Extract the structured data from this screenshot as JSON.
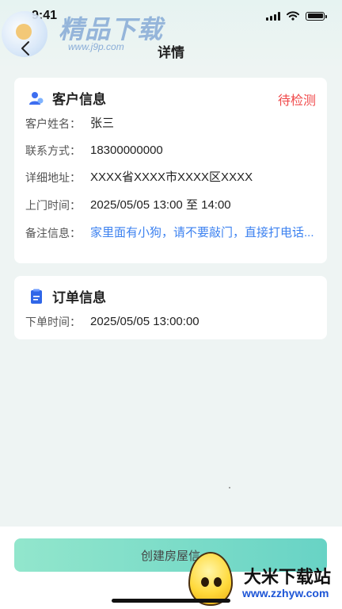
{
  "status_bar": {
    "time": "9:41"
  },
  "watermark_top": {
    "title": "精品下载",
    "url": "www.j9p.com"
  },
  "header": {
    "back_icon": "chevron-left-icon",
    "title": "详情"
  },
  "customer_card": {
    "title": "客户信息",
    "icon": "user-icon",
    "status": "待检测",
    "status_color": "#f0494a",
    "rows": [
      {
        "label": "客户姓名：",
        "value": "张三"
      },
      {
        "label": "联系方式：",
        "value": "18300000000"
      },
      {
        "label": "详细地址：",
        "value": "XXXX省XXXX市XXXX区XXXX"
      },
      {
        "label": "上门时间：",
        "value": "2025/05/05  13:00 至 14:00"
      },
      {
        "label": "备注信息：",
        "value": "家里面有小狗，请不要敲门，直接打电话..."
      }
    ]
  },
  "order_card": {
    "title": "订单信息",
    "icon": "document-icon",
    "rows": [
      {
        "label": "下单时间：",
        "value": "2025/05/05  13:00:00"
      }
    ]
  },
  "bottom": {
    "button_label": "创建房屋信"
  },
  "watermark_bottom": {
    "title": "大米下载站",
    "url": "www.zzhyw.com"
  },
  "colors": {
    "accent": "#3d82f0",
    "button_start": "#92e6cc",
    "button_end": "#68d3c5"
  }
}
